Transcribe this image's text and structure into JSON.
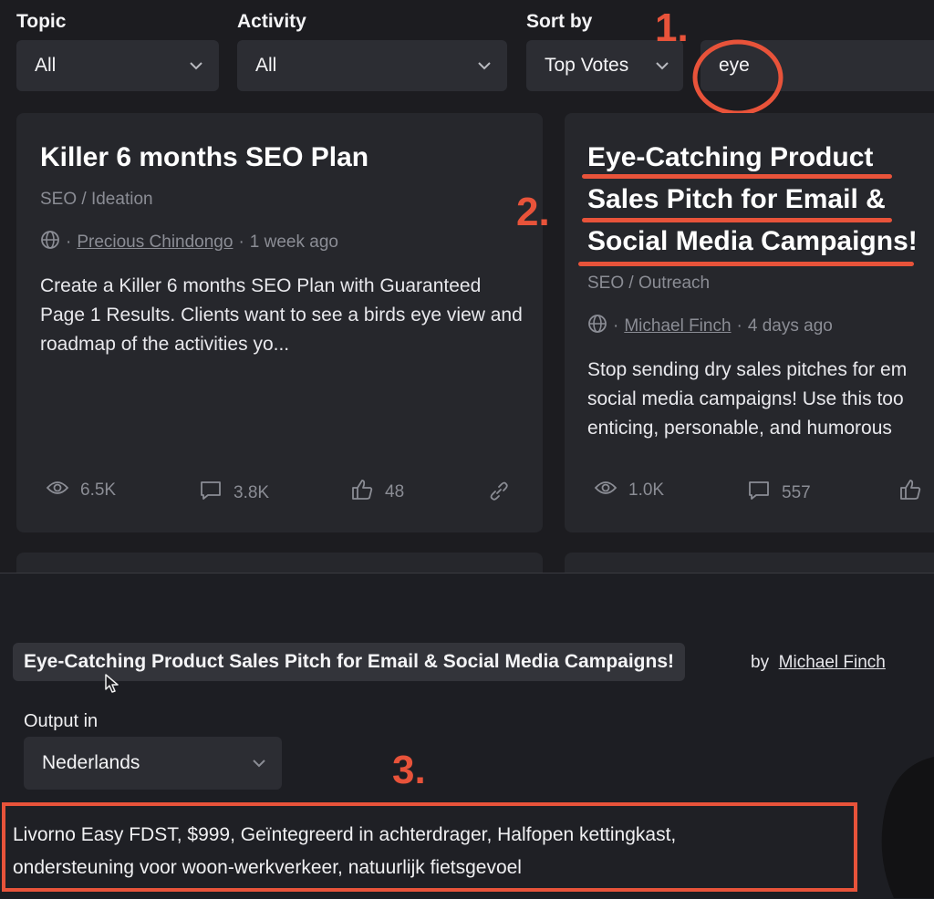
{
  "filters": {
    "topic": {
      "label": "Topic",
      "value": "All"
    },
    "activity": {
      "label": "Activity",
      "value": "All"
    },
    "sort": {
      "label": "Sort by",
      "value": "Top Votes"
    },
    "search": {
      "value": "eye"
    }
  },
  "annotations": {
    "one": "1.",
    "two": "2.",
    "three": "3."
  },
  "annotation_color": "#e8533a",
  "cards": [
    {
      "title": "Killer 6 months SEO Plan",
      "category": "SEO / Ideation",
      "author": "Precious Chindongo",
      "time": "1 week ago",
      "desc": "Create a Killer 6 months SEO Plan with Guaranteed Page 1 Results. Clients want to see a birds eye view and roadmap of the activities yo...",
      "views": "6.5K",
      "comments": "3.8K",
      "likes": "48"
    },
    {
      "title": "Eye-Catching Product Sales Pitch for Email & Social Media Campaigns!",
      "title_lines": [
        "Eye-Catching Product",
        "Sales Pitch for Email &",
        "Social Media Campaigns!"
      ],
      "category": "SEO / Outreach",
      "author": "Michael Finch",
      "time": "4 days ago",
      "desc_lines": [
        "Stop sending dry sales pitches for em",
        "social media campaigns! Use this too",
        "enticing, personable, and humorous"
      ],
      "views": "1.0K",
      "comments": "557"
    }
  ],
  "tool": {
    "title": "Eye-Catching Product Sales Pitch for Email & Social Media Campaigns!",
    "by": "by",
    "author": "Michael Finch",
    "output_label": "Output in",
    "output_value": "Nederlands",
    "input_lines": [
      "Livorno Easy FDST, $999, Geïntegreerd in achterdrager, Halfopen kettingkast,",
      "ondersteuning voor woon-werkverkeer, natuurlijk fietsgevoel"
    ]
  }
}
